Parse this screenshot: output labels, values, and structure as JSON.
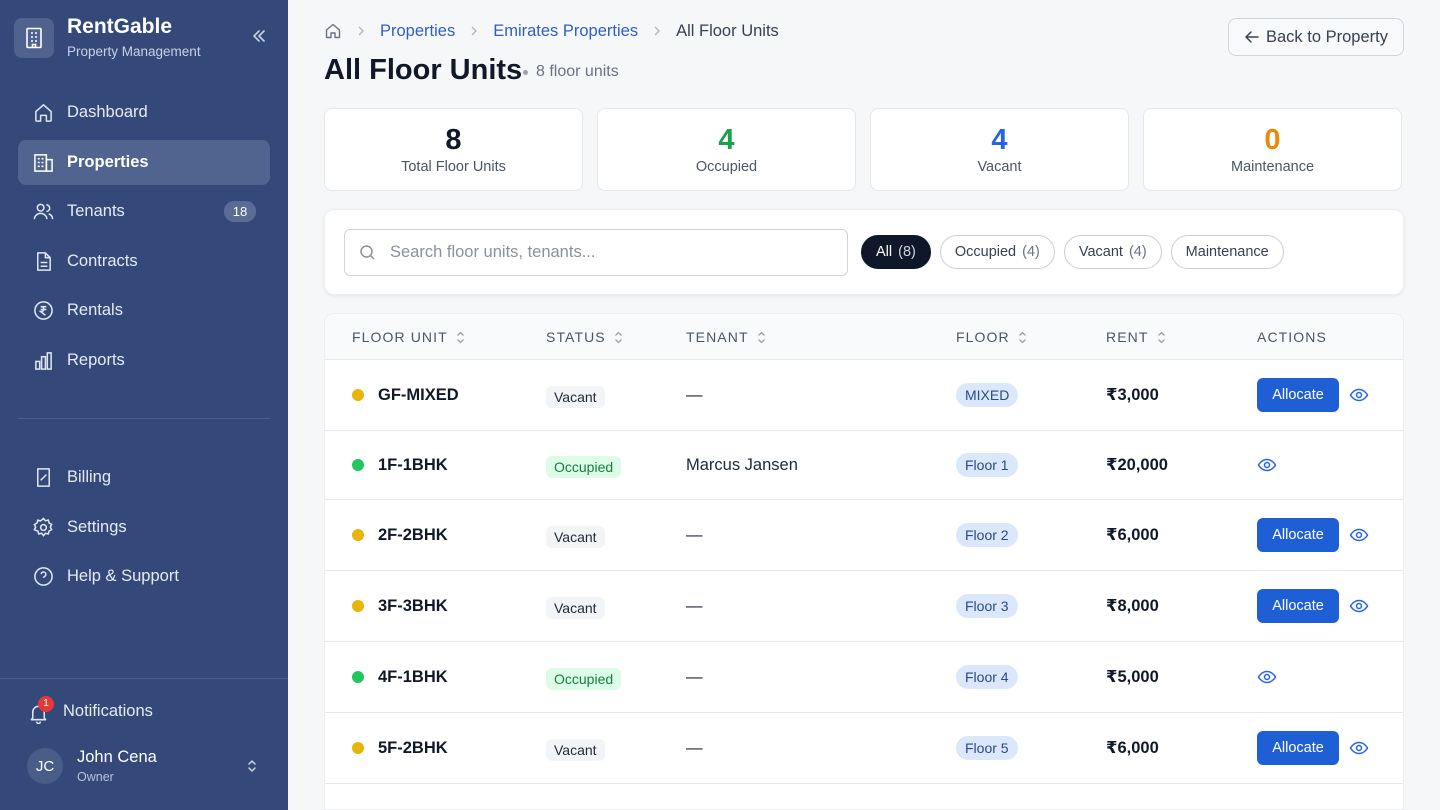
{
  "brand": {
    "name": "RentGable",
    "subtitle": "Property Management"
  },
  "nav": [
    {
      "label": "Dashboard",
      "icon": "home-icon",
      "active": false
    },
    {
      "label": "Properties",
      "icon": "building-icon",
      "active": true
    },
    {
      "label": "Tenants",
      "icon": "users-icon",
      "active": false,
      "badge": "18"
    },
    {
      "label": "Contracts",
      "icon": "document-icon",
      "active": false
    },
    {
      "label": "Rentals",
      "icon": "rupee-circle-icon",
      "active": false
    },
    {
      "label": "Reports",
      "icon": "bar-chart-icon",
      "active": false
    }
  ],
  "nav2": [
    {
      "label": "Billing",
      "icon": "receipt-icon"
    },
    {
      "label": "Settings",
      "icon": "gear-icon"
    },
    {
      "label": "Help & Support",
      "icon": "help-circle-icon"
    }
  ],
  "notifications": {
    "label": "Notifications",
    "count": "1"
  },
  "user": {
    "initials": "JC",
    "name": "John Cena",
    "role": "Owner"
  },
  "breadcrumbs": {
    "items": [
      "Properties",
      "Emirates Properties"
    ],
    "current": "All Floor Units"
  },
  "back_button": "Back to Property",
  "page": {
    "title": "All Floor Units",
    "count_text": "8 floor units"
  },
  "stats": [
    {
      "value": "8",
      "label": "Total Floor Units",
      "color": "#111827"
    },
    {
      "value": "4",
      "label": "Occupied",
      "color": "#16a34a"
    },
    {
      "value": "4",
      "label": "Vacant",
      "color": "#2563eb"
    },
    {
      "value": "0",
      "label": "Maintenance",
      "color": "#ea8a0c"
    }
  ],
  "search": {
    "placeholder": "Search floor units, tenants..."
  },
  "filters": [
    {
      "label": "All",
      "count": "(8)",
      "active": true
    },
    {
      "label": "Occupied",
      "count": "(4)",
      "active": false
    },
    {
      "label": "Vacant",
      "count": "(4)",
      "active": false
    },
    {
      "label": "Maintenance",
      "count": "",
      "active": false
    }
  ],
  "table": {
    "columns": [
      "FLOOR UNIT",
      "STATUS",
      "TENANT",
      "FLOOR",
      "RENT",
      "ACTIONS"
    ],
    "action_label": "Allocate",
    "rows": [
      {
        "unit": "GF-MIXED",
        "status": "Vacant",
        "tenant": "—",
        "floor": "MIXED",
        "rent": "₹3,000",
        "dot": "#eab308"
      },
      {
        "unit": "1F-1BHK",
        "status": "Occupied",
        "tenant": "Marcus Jansen",
        "floor": "Floor 1",
        "rent": "₹20,000",
        "dot": "#22c55e"
      },
      {
        "unit": "2F-2BHK",
        "status": "Vacant",
        "tenant": "—",
        "floor": "Floor 2",
        "rent": "₹6,000",
        "dot": "#eab308"
      },
      {
        "unit": "3F-3BHK",
        "status": "Vacant",
        "tenant": "—",
        "floor": "Floor 3",
        "rent": "₹8,000",
        "dot": "#eab308"
      },
      {
        "unit": "4F-1BHK",
        "status": "Occupied",
        "tenant": "—",
        "floor": "Floor 4",
        "rent": "₹5,000",
        "dot": "#22c55e"
      },
      {
        "unit": "5F-2BHK",
        "status": "Vacant",
        "tenant": "—",
        "floor": "Floor 5",
        "rent": "₹6,000",
        "dot": "#eab308"
      }
    ]
  }
}
